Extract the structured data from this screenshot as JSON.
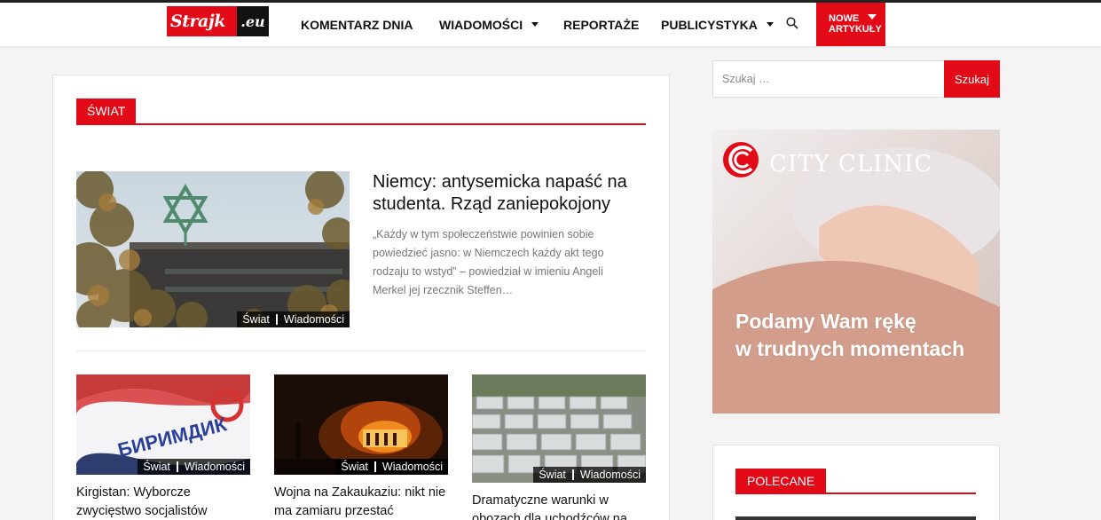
{
  "header": {
    "logo_main": "Strajk",
    "logo_ext": ".eu",
    "nav": [
      {
        "label": "KOMENTARZ DNIA",
        "dropdown": false
      },
      {
        "label": "WIADOMOŚCI",
        "dropdown": true
      },
      {
        "label": "REPORTAŻE",
        "dropdown": false
      },
      {
        "label": "PUBLICYSTYKA",
        "dropdown": true
      }
    ],
    "search_icon": "search-icon",
    "nowe_line1": "NOWE",
    "nowe_line2": "ARTYKUŁY"
  },
  "section": {
    "label": "ŚWIAT"
  },
  "featured": {
    "title": "Niemcy: antysemicka napaść na studenta. Rząd zaniepokojony",
    "excerpt": "„Każdy w tym społeczeństwie powinien sobie powiedzieć jasno: w Niemczech każdy akt tego rodzaju to wstyd” – powiedział w imieniu Angeli Merkel jej rzecznik Steffen…",
    "tags": [
      "Świat",
      "Wiadomości"
    ]
  },
  "cards": [
    {
      "title": "Kirgistan: Wyborcze zwycięstwo socjalistów",
      "tags": [
        "Świat",
        "Wiadomości"
      ],
      "flag_text": "БИРИМДИК"
    },
    {
      "title": "Wojna na Zakaukaziu: nikt nie ma zamiaru przestać",
      "tags": [
        "Świat",
        "Wiadomości"
      ]
    },
    {
      "title": "Dramatyczne warunki w obozach dla uchodźców na",
      "tags": [
        "Świat",
        "Wiadomości"
      ]
    }
  ],
  "sidebar": {
    "search_placeholder": "Szukaj …",
    "search_button": "Szukaj",
    "ad": {
      "brand": "CITY CLINIC",
      "line1": "Podamy Wam rękę",
      "line2": "w trudnych momentach"
    },
    "polecane_label": "POLECANE"
  },
  "colors": {
    "accent": "#e20a16",
    "text": "#111111",
    "muted": "#777777"
  }
}
